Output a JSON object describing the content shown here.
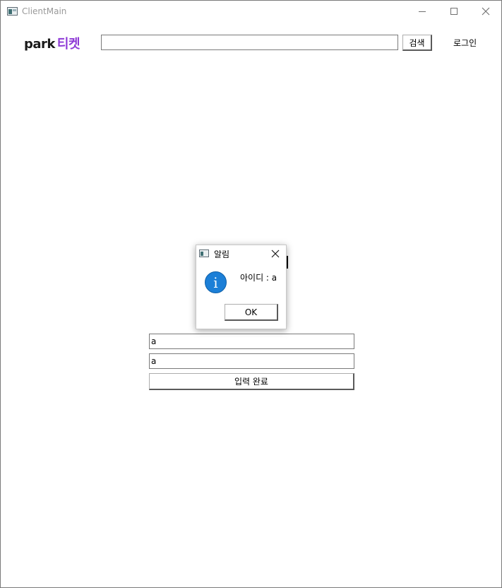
{
  "window": {
    "title": "ClientMain"
  },
  "header": {
    "logo_park": "park",
    "logo_ticket": "티켓",
    "logo_ticket_color": "#8e3ad6",
    "search_value": "",
    "search_button": "검색",
    "login_label": "로그인"
  },
  "form": {
    "id_value": "a",
    "password_value": "a",
    "submit_label": "입력 완료"
  },
  "dialog": {
    "title": "알림",
    "icon": "info-icon",
    "message": "아이디 : a",
    "ok_label": "OK"
  }
}
